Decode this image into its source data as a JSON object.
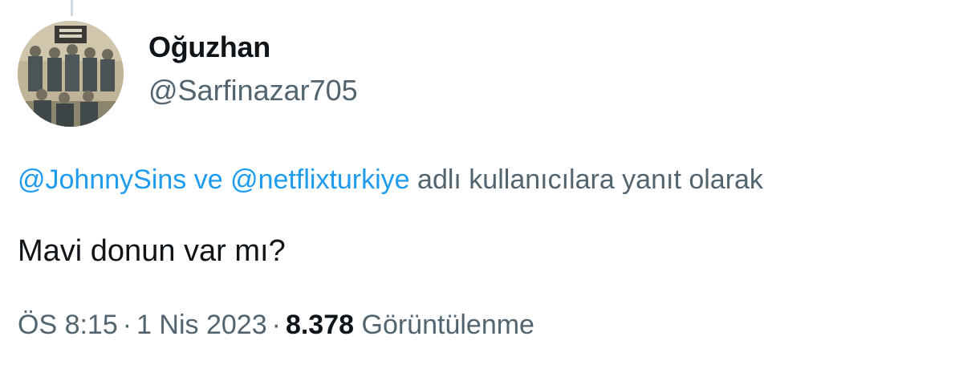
{
  "tweet": {
    "display_name": "Oğuzhan",
    "handle": "@Sarfinazar705",
    "reply_context": {
      "mention_1": "@JohnnySins",
      "conjunction": " ve ",
      "mention_2": "@netflixturkiye",
      "suffix": " adlı kullanıcılara yanıt olarak"
    },
    "text": "Mavi donun var mı?",
    "meta": {
      "time": "ÖS 8:15",
      "separator": "·",
      "date": "1 Nis 2023",
      "views_count": "8.378",
      "views_label": "Görüntülenme"
    }
  },
  "colors": {
    "link": "#1d9bf0",
    "secondary_text": "#536471",
    "primary_text": "#0f1419"
  }
}
